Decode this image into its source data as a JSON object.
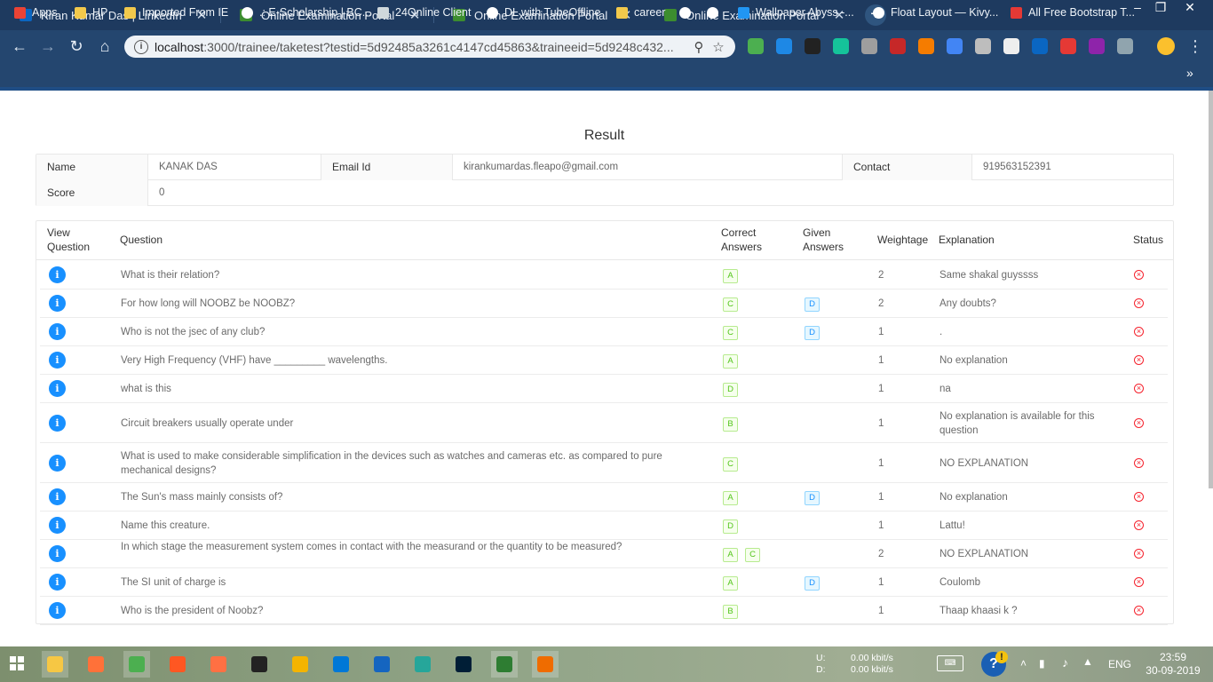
{
  "browser": {
    "tabs": [
      {
        "title": "Kiran Kumar Das | LinkedIn",
        "favicon_color": "#0a66c2",
        "active": false
      },
      {
        "title": "Online Examination Portal",
        "favicon_color": "#3c8d2f",
        "active": false
      },
      {
        "title": "Online Examination Portal",
        "favicon_color": "#3c8d2f",
        "active": false
      },
      {
        "title": "Online Examination Portal",
        "favicon_color": "#3c8d2f",
        "active": true
      }
    ],
    "new_tab_symbol": "+",
    "url_host": "localhost",
    "url_path": ":3000/trainee/taketest?testid=5d92485a3261c4147cd45863&traineeid=5d9248c432...",
    "bookmarks": [
      {
        "label": "Apps",
        "icon": "apps-grid-icon"
      },
      {
        "label": "HP",
        "icon": "folder-icon"
      },
      {
        "label": "Imported From IE",
        "icon": "folder-icon"
      },
      {
        "label": ".: E-Scholarship | BC...",
        "icon": "globe-icon"
      },
      {
        "label": "24Online Client",
        "icon": "cloud-icon"
      },
      {
        "label": "DL with TubeOffline",
        "icon": "globe-icon"
      },
      {
        "label": "career",
        "icon": "folder-icon"
      },
      {
        "label": "",
        "icon": "globe-icon"
      },
      {
        "label": "",
        "icon": "github-icon"
      },
      {
        "label": "Wallpaper Abyss -...",
        "icon": "wallpaper-icon"
      },
      {
        "label": "Float Layout — Kivy...",
        "icon": "kivy-icon"
      },
      {
        "label": "All Free Bootstrap T...",
        "icon": "s-icon"
      }
    ]
  },
  "page": {
    "title": "Result",
    "info": {
      "name_label": "Name",
      "name_value": "KANAK DAS",
      "email_label": "Email Id",
      "email_value": "kirankumardas.fleapo@gmail.com",
      "contact_label": "Contact",
      "contact_value": "919563152391",
      "score_label": "Score",
      "score_value": "0"
    },
    "columns": {
      "view_question": "View\nQuestion",
      "question": "Question",
      "correct_answers": "Correct\nAnswers",
      "given_answers": "Given\nAnswers",
      "weightage": "Weightage",
      "explanation": "Explanation",
      "status": "Status"
    },
    "rows": [
      {
        "question": "What is their relation?",
        "correct": [
          "A"
        ],
        "given": [],
        "weightage": "2",
        "explanation": "Same shakal guyssss",
        "status": "wrong"
      },
      {
        "question": "For how long will NOOBZ be NOOBZ?",
        "correct": [
          "C"
        ],
        "given": [
          "D"
        ],
        "weightage": "2",
        "explanation": "Any doubts?",
        "status": "wrong"
      },
      {
        "question": "Who is not the jsec of any club?",
        "correct": [
          "C"
        ],
        "given": [
          "D"
        ],
        "weightage": "1",
        "explanation": ".",
        "status": "wrong"
      },
      {
        "question": "Very High Frequency (VHF) have _________ wavelengths.",
        "correct": [
          "A"
        ],
        "given": [],
        "weightage": "1",
        "explanation": "No explanation",
        "status": "wrong"
      },
      {
        "question": "what is this",
        "correct": [
          "D"
        ],
        "given": [],
        "weightage": "1",
        "explanation": "na",
        "status": "wrong"
      },
      {
        "question": "Circuit breakers usually operate under",
        "correct": [
          "B"
        ],
        "given": [],
        "weightage": "1",
        "explanation": "No explanation is available for this question",
        "status": "wrong"
      },
      {
        "question": "What is used to make considerable simplification in the devices such as watches and cameras etc. as compared to pure mechanical designs?",
        "correct": [
          "C"
        ],
        "given": [],
        "weightage": "1",
        "explanation": "NO EXPLANATION",
        "status": "wrong"
      },
      {
        "question": "The Sun's mass mainly consists of?",
        "correct": [
          "A"
        ],
        "given": [
          "D"
        ],
        "weightage": "1",
        "explanation": "No explanation",
        "status": "wrong"
      },
      {
        "question": "Name this creature.",
        "correct": [
          "D"
        ],
        "given": [],
        "weightage": "1",
        "explanation": "Lattu!",
        "status": "wrong"
      },
      {
        "question": "In which stage the measurement system comes in contact with the measurand or the quantity to be measured?",
        "correct": [
          "A",
          "C"
        ],
        "given": [],
        "weightage": "2",
        "explanation": "NO EXPLANATION",
        "status": "wrong"
      },
      {
        "question": "The SI unit of charge is",
        "correct": [
          "A"
        ],
        "given": [
          "D"
        ],
        "weightage": "1",
        "explanation": "Coulomb",
        "status": "wrong"
      },
      {
        "question": "Who is the president of Noobz?",
        "correct": [
          "B"
        ],
        "given": [],
        "weightage": "1",
        "explanation": "Thaap khaasi k ?",
        "status": "wrong"
      }
    ],
    "view_icon_glyph": "i",
    "status_icon_glyph": "×"
  },
  "taskbar": {
    "net_up_label": "U:",
    "net_up_value": "0.00 kbit/s",
    "net_down_label": "D:",
    "net_down_value": "0.00 kbit/s",
    "language": "ENG",
    "time": "23:59",
    "date": "30-09-2019"
  },
  "colors": {
    "tabstrip": "#1e3a5f",
    "toolbar": "#24466f",
    "accent_blue": "#1890ff",
    "correct_green": "#52c41a",
    "error_red": "#f5222d"
  }
}
